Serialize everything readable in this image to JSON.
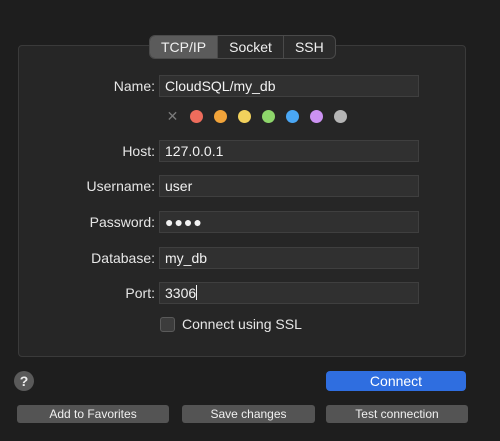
{
  "tabs": [
    {
      "label": "TCP/IP",
      "active": true
    },
    {
      "label": "Socket",
      "active": false
    },
    {
      "label": "SSH",
      "active": false
    }
  ],
  "form": {
    "name": {
      "label": "Name:",
      "value": "CloudSQL/my_db"
    },
    "host": {
      "label": "Host:",
      "value": "127.0.0.1"
    },
    "username": {
      "label": "Username:",
      "value": "user"
    },
    "password": {
      "label": "Password:",
      "value": "●●●●"
    },
    "database": {
      "label": "Database:",
      "value": "my_db"
    },
    "port": {
      "label": "Port:",
      "value": "3306"
    }
  },
  "color_tags": {
    "clear_icon": "x-icon",
    "colors": [
      "#ee6c5c",
      "#f2a43a",
      "#f2d15c",
      "#8ed66b",
      "#4aa7f5",
      "#cc92f2",
      "#b5b5b5"
    ]
  },
  "ssl": {
    "label": "Connect using SSL",
    "checked": false
  },
  "help": {
    "label": "?"
  },
  "buttons": {
    "connect": "Connect",
    "add_favorites": "Add to Favorites",
    "save_changes": "Save changes",
    "test_connection": "Test connection"
  }
}
